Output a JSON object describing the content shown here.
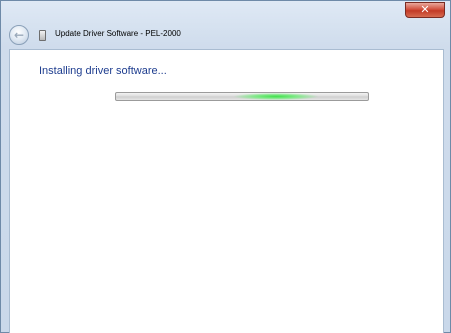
{
  "window": {
    "title": "Update Driver Software - PEL-2000",
    "close_label": "✕"
  },
  "nav": {
    "back_icon": "back-arrow-icon",
    "device_icon": "device-icon"
  },
  "main": {
    "status_heading": "Installing driver software...",
    "progress": {
      "mode": "indeterminate",
      "color": "#3fe04a"
    }
  },
  "colors": {
    "heading": "#1e3d8f",
    "frame": "#cfdcec"
  }
}
